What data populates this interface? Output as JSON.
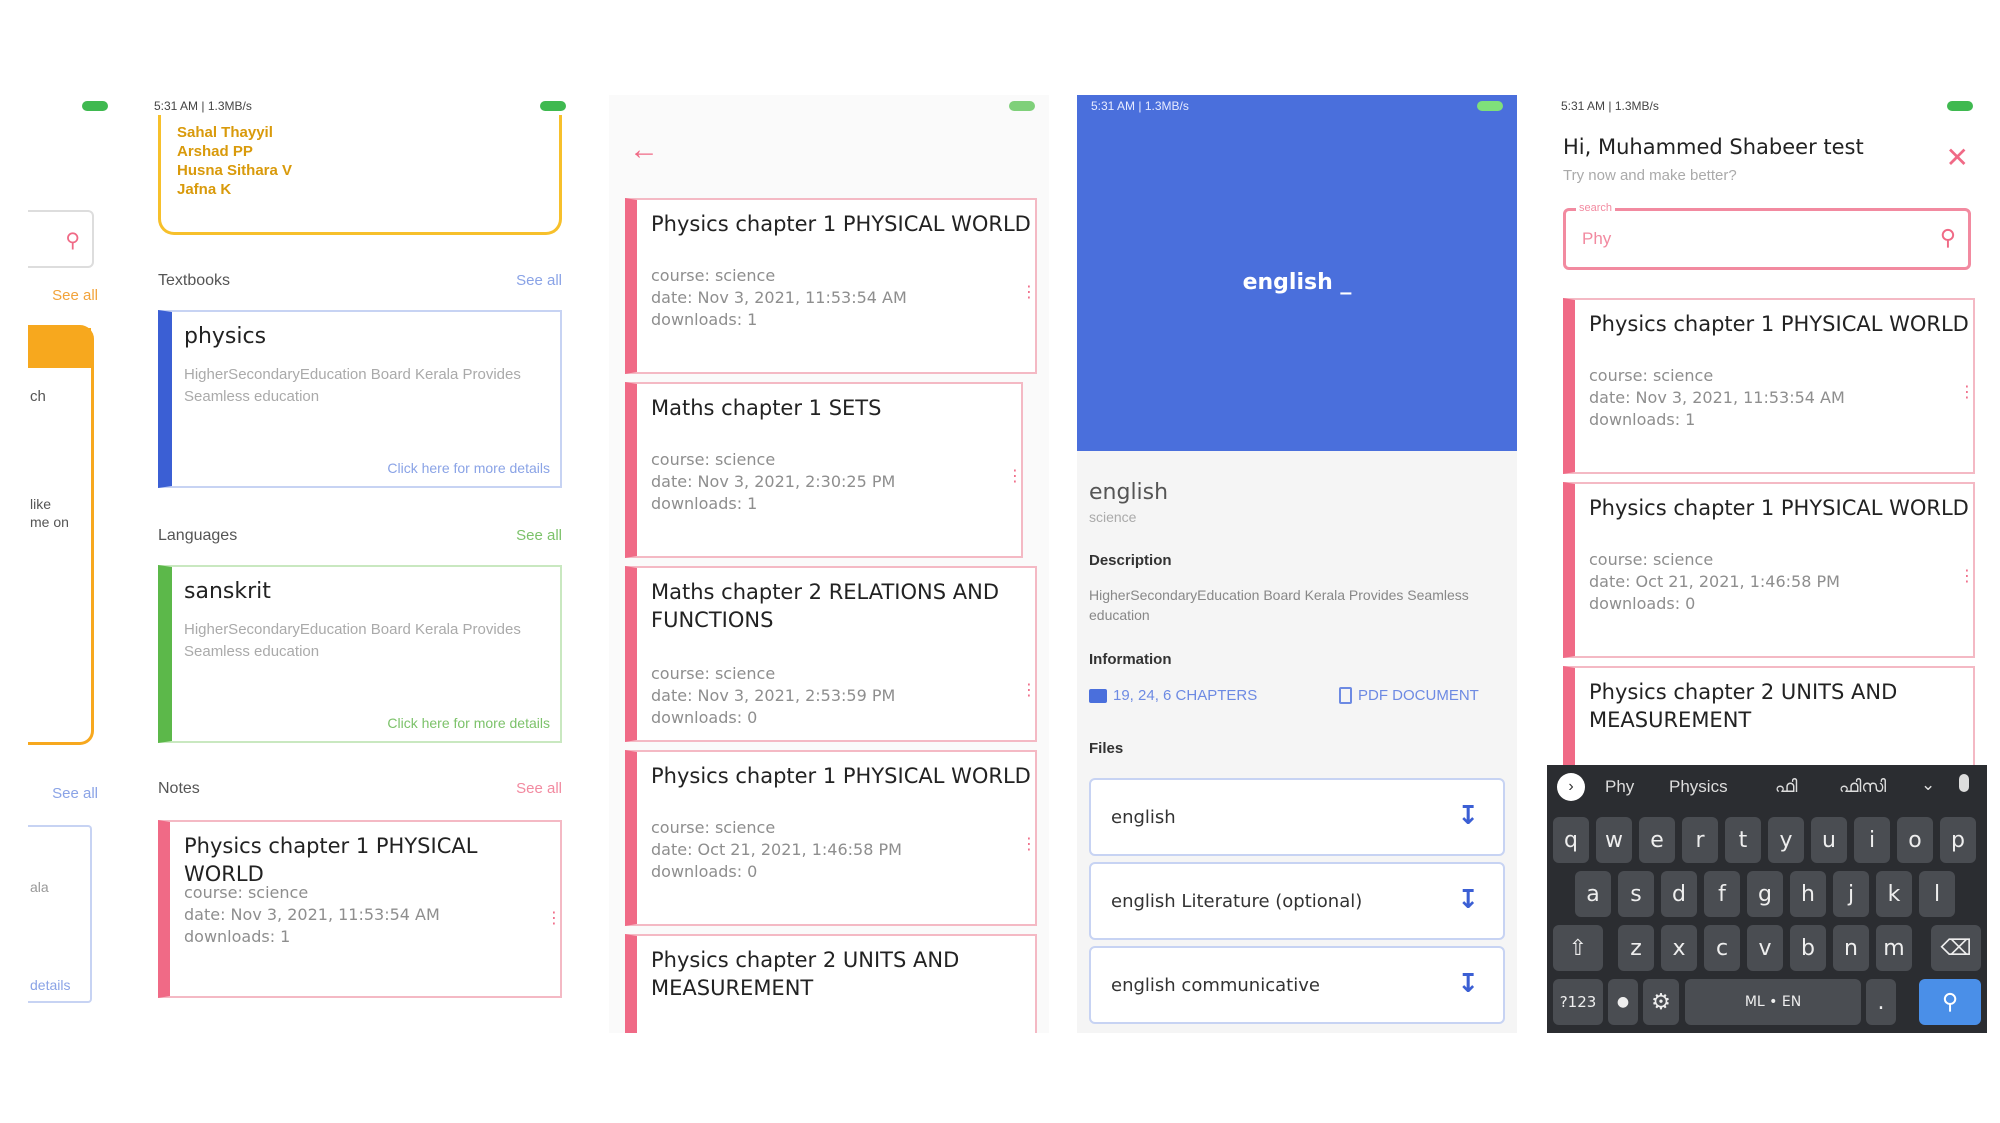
{
  "panel1": {
    "see_all_1": "See all",
    "see_all_2": "See all",
    "frag_ch": "ch",
    "frag_like": "like",
    "frag_me_on": "me on",
    "frag_ala": "ala",
    "frag_details": "details"
  },
  "panel2": {
    "status_time": "5:31 AM | 1.3MB/s",
    "names": [
      "Sahal Thayyil",
      "Arshad PP",
      "Husna Sithara V",
      "Jafna K"
    ],
    "textbooks_title": "Textbooks",
    "textbooks_see_all": "See all",
    "textbook": {
      "title": "physics",
      "desc": "HigherSecondaryEducation Board Kerala Provides Seamless education",
      "link": "Click here for more details",
      "accent": "#3b5fd4"
    },
    "languages_title": "Languages",
    "languages_see_all": "See all",
    "language": {
      "title": "sanskrit",
      "desc": "HigherSecondaryEducation Board Kerala Provides Seamless education",
      "link": "Click here for more details",
      "accent": "#5cb84a"
    },
    "notes_title": "Notes",
    "notes_see_all": "See all",
    "note": {
      "title": "Physics chapter 1 PHYSICAL WORLD",
      "course": "course: science",
      "date": "date: Nov 3, 2021, 11:53:54 AM",
      "downloads": "downloads: 1"
    }
  },
  "panel3": {
    "back_icon": "arrow-left-icon",
    "notes": [
      {
        "title": "Physics chapter 1 PHYSICAL WORLD",
        "course": "course: science",
        "date": "date: Nov 3, 2021, 11:53:54 AM",
        "downloads": "downloads: 1"
      },
      {
        "title": "Maths chapter 1 SETS",
        "course": "course: science",
        "date": "date: Nov 3, 2021, 2:30:25 PM",
        "downloads": "downloads: 1"
      },
      {
        "title": "Maths chapter 2 RELATIONS AND FUNCTIONS",
        "course": "course: science",
        "date": "date: Nov 3, 2021, 2:53:59 PM",
        "downloads": "downloads: 0"
      },
      {
        "title": "Physics chapter 1 PHYSICAL WORLD",
        "course": "course: science",
        "date": "date: Oct 21, 2021, 1:46:58 PM",
        "downloads": "downloads: 0"
      },
      {
        "title": "Physics chapter 2 UNITS AND MEASUREMENT"
      }
    ]
  },
  "panel4": {
    "status_time": "5:31 AM | 1.3MB/s",
    "banner_title": "english _",
    "banner_color": "#4a6fdc",
    "book_title": "english",
    "book_sub": "science",
    "description_label": "Description",
    "description": "HigherSecondaryEducation Board Kerala Provides Seamless education",
    "information_label": "Information",
    "chapters": "19, 24, 6 CHAPTERS",
    "doc_type": "PDF DOCUMENT",
    "files_label": "Files",
    "files": [
      "english",
      "english Literature (optional)",
      "english communicative"
    ]
  },
  "panel5": {
    "status_time": "5:31 AM | 1.3MB/s",
    "greeting": "Hi, Muhammed Shabeer test",
    "sub": "Try now and make better?",
    "search_label": "search",
    "search_value": "Phy",
    "notes": [
      {
        "title": "Physics chapter 1 PHYSICAL WORLD",
        "course": "course: science",
        "date": "date: Nov 3, 2021, 11:53:54 AM",
        "downloads": "downloads: 1"
      },
      {
        "title": "Physics chapter 1 PHYSICAL WORLD",
        "course": "course: science",
        "date": "date: Oct 21, 2021, 1:46:58 PM",
        "downloads": "downloads: 0"
      },
      {
        "title": "Physics chapter 2 UNITS AND MEASUREMENT"
      }
    ],
    "keyboard": {
      "suggestions": [
        "Phy",
        "Physics",
        "ഫി",
        "ഫിസി"
      ],
      "row1": [
        "q",
        "w",
        "e",
        "r",
        "t",
        "y",
        "u",
        "i",
        "o",
        "p"
      ],
      "row2": [
        "a",
        "s",
        "d",
        "f",
        "g",
        "h",
        "j",
        "k",
        "l"
      ],
      "row3": [
        "z",
        "x",
        "c",
        "v",
        "b",
        "n",
        "m"
      ],
      "sym": "?123",
      "space": "ML • EN",
      "period": "."
    }
  }
}
